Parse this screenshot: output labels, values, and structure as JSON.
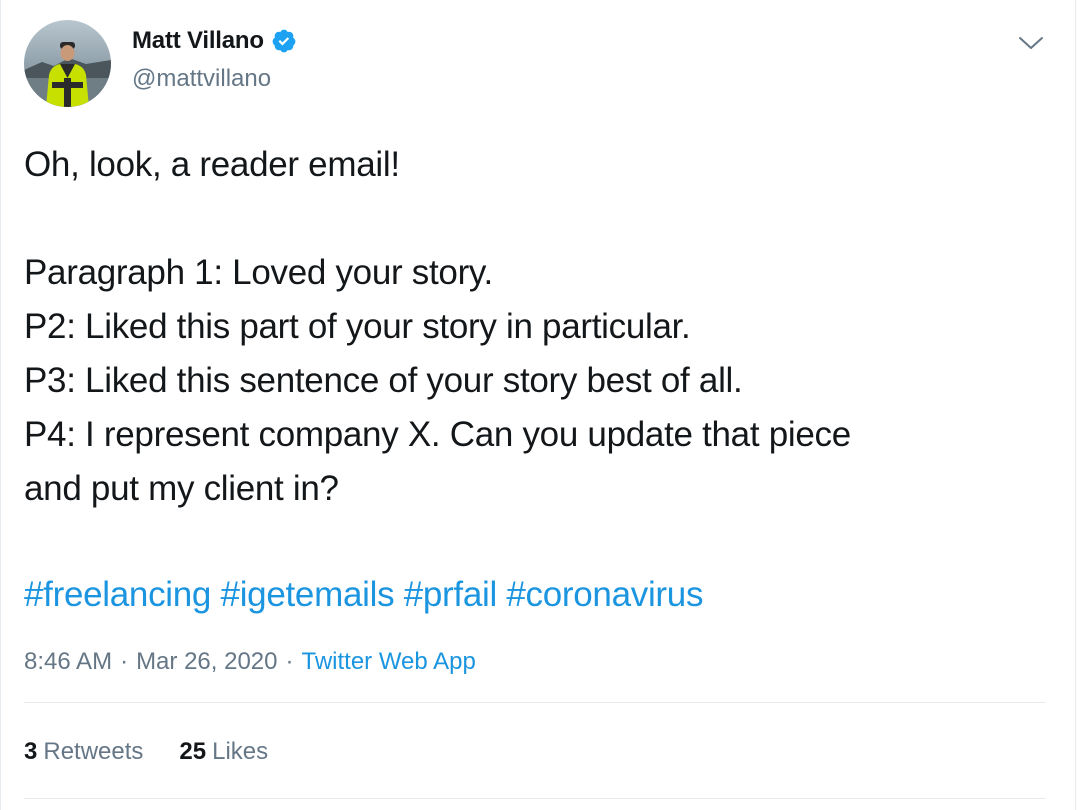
{
  "author": {
    "display_name": "Matt Villano",
    "handle": "@mattvillano",
    "verified": true
  },
  "tweet": {
    "lines": [
      "Oh, look, a reader email!",
      "",
      "Paragraph 1: Loved your story.",
      "P2: Liked this part of your story in particular.",
      "P3: Liked this sentence of your story best of all.",
      "P4: I represent company X. Can you update that piece",
      "and put my client in?"
    ],
    "hashtags": [
      "#freelancing",
      "#igetemails",
      "#prfail",
      "#coronavirus"
    ]
  },
  "meta": {
    "time": "8:46 AM",
    "separator": "·",
    "date": "Mar 26, 2020",
    "source": "Twitter Web App"
  },
  "stats": {
    "retweets_count": "3",
    "retweets_label": "Retweets",
    "likes_count": "25",
    "likes_label": "Likes"
  },
  "colors": {
    "link": "#1b95e0",
    "text": "#14171a",
    "secondary": "#657786",
    "verified": "#1da1f2",
    "divider": "#e6ecf0"
  },
  "icons": {
    "verified": "verified-badge-icon",
    "menu": "chevron-down-icon"
  }
}
